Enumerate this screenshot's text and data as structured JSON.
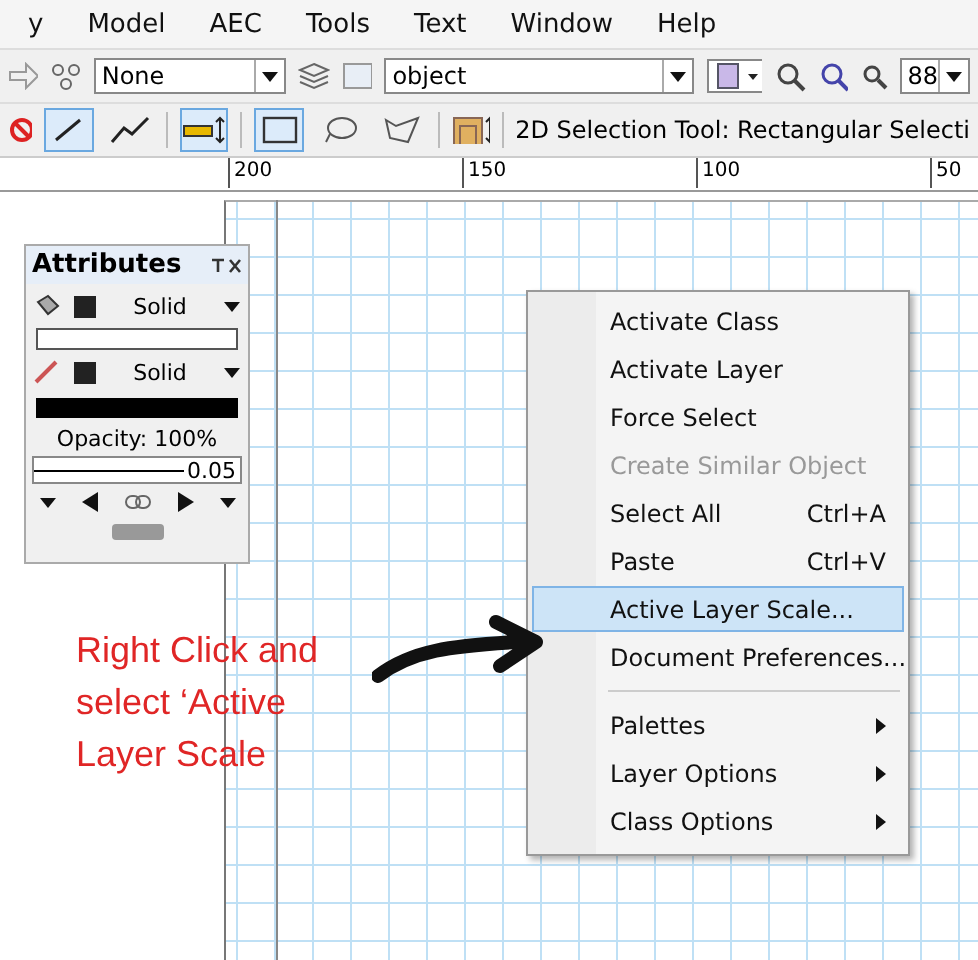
{
  "menu_bar": [
    "y",
    "Model",
    "AEC",
    "Tools",
    "Text",
    "Window",
    "Help"
  ],
  "view_bar": {
    "class_select": "None",
    "layer_select": "object",
    "zoom": "88"
  },
  "tool_bar": {
    "modes": [
      {
        "kind": "line",
        "selected": true
      },
      {
        "kind": "polyline",
        "selected": false
      },
      {
        "kind": "connect",
        "selected": true
      },
      {
        "kind": "rectangle",
        "selected": true
      },
      {
        "kind": "lasso",
        "selected": false
      },
      {
        "kind": "polygon",
        "selected": false
      }
    ],
    "help_text": "2D Selection Tool: Rectangular Selecti"
  },
  "ruler": [
    "200",
    "150",
    "100",
    "50"
  ],
  "attributes": {
    "title": "Attributes",
    "fill_style": "Solid",
    "pen_style": "Solid",
    "opacity": "Opacity: 100%",
    "line_weight": "0.05"
  },
  "context_menu": [
    {
      "kind": "command",
      "label": "Activate Class",
      "disabled": false,
      "selected": false
    },
    {
      "kind": "command",
      "label": "Activate Layer",
      "disabled": false,
      "selected": false
    },
    {
      "kind": "command",
      "label": "Force Select",
      "disabled": false,
      "selected": false
    },
    {
      "kind": "command",
      "label": "Create Similar Object",
      "disabled": true,
      "selected": false
    },
    {
      "kind": "command",
      "label": "Select All",
      "shortcut": "Ctrl+A",
      "disabled": false,
      "selected": false
    },
    {
      "kind": "command",
      "label": "Paste",
      "shortcut": "Ctrl+V",
      "disabled": false,
      "selected": false
    },
    {
      "kind": "command",
      "label": "Active Layer Scale...",
      "disabled": false,
      "selected": true
    },
    {
      "kind": "command",
      "label": "Document Preferences...",
      "disabled": false,
      "selected": false
    },
    {
      "kind": "separator"
    },
    {
      "kind": "submenu",
      "label": "Palettes",
      "disabled": false,
      "selected": false
    },
    {
      "kind": "submenu",
      "label": "Layer Options",
      "disabled": false,
      "selected": false
    },
    {
      "kind": "submenu",
      "label": "Class Options",
      "disabled": false,
      "selected": false
    }
  ],
  "annotation": "Right Click and select ‘Active Layer Scale"
}
